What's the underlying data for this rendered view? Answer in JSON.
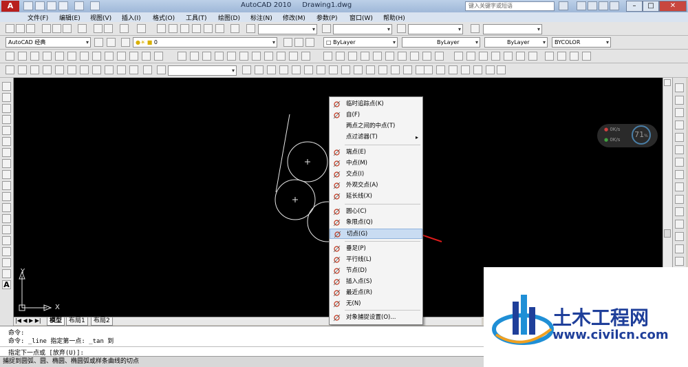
{
  "window": {
    "title": "AutoCAD 2010",
    "document": "Drawing1.dwg",
    "app_logo": "A",
    "help_search_placeholder": "键入关键字或短语",
    "controls": [
      "–",
      "□",
      "✕"
    ]
  },
  "menubar": {
    "items": [
      "文件(F)",
      "编辑(E)",
      "视图(V)",
      "插入(I)",
      "格式(O)",
      "工具(T)",
      "绘图(D)",
      "标注(N)",
      "修改(M)",
      "参数(P)",
      "窗口(W)",
      "帮助(H)"
    ]
  },
  "toolbars": {
    "workspace": "AutoCAD 经典",
    "layer": "0",
    "color": "ByLayer",
    "linetype": "ByLayer",
    "lineweight": "ByLayer",
    "plotstyle": "BYCOLOR"
  },
  "ucs": {
    "x_label": "X",
    "y_label": "Y"
  },
  "layout_tabs": [
    "模型",
    "布局1",
    "布局2"
  ],
  "context_menu": {
    "items": [
      {
        "label": "临时追踪点(K)",
        "icon": "temp-track-icon"
      },
      {
        "label": "自(F)",
        "icon": "from-icon"
      },
      {
        "label": "两点之间的中点(T)",
        "icon": ""
      },
      {
        "label": "点过滤器(T)",
        "icon": "",
        "submenu": "▸"
      },
      {
        "label": "端点(E)",
        "icon": "endpoint-icon"
      },
      {
        "label": "中点(M)",
        "icon": "midpoint-icon"
      },
      {
        "label": "交点(I)",
        "icon": "intersection-icon"
      },
      {
        "label": "外观交点(A)",
        "icon": "apparent-intersection-icon"
      },
      {
        "label": "延长线(X)",
        "icon": "extension-icon"
      },
      {
        "label": "圆心(C)",
        "icon": "center-icon"
      },
      {
        "label": "象限点(Q)",
        "icon": "quadrant-icon"
      },
      {
        "label": "切点(G)",
        "icon": "tangent-icon",
        "highlight": true
      },
      {
        "label": "垂足(P)",
        "icon": "perpendicular-icon"
      },
      {
        "label": "平行线(L)",
        "icon": "parallel-icon"
      },
      {
        "label": "节点(D)",
        "icon": "node-icon"
      },
      {
        "label": "插入点(S)",
        "icon": "insert-icon"
      },
      {
        "label": "最近点(R)",
        "icon": "nearest-icon"
      },
      {
        "label": "无(N)",
        "icon": "none-icon"
      },
      {
        "label": "对象捕捉设置(O)...",
        "icon": "osnap-settings-icon"
      }
    ]
  },
  "gauge": {
    "percent": "71",
    "percent_sign": "%",
    "rate1": "0K/s",
    "rate2": "0K/s"
  },
  "command_line": {
    "lines": [
      "命令:",
      "命令: _line 指定第一点: _tan 到",
      "指定下一点或 [放弃(U)]:"
    ]
  },
  "status_text": "捕捉到圆弧、圆、椭圆、椭圆弧或样条曲线的切点",
  "watermark": {
    "name": "土木工程网",
    "url": "www.civilcn.com"
  },
  "colors": {
    "canvas": "#000000",
    "menu_highlight": "#c9dcf2",
    "arrow": "#e01b1b",
    "watermark_blue": "#1f3f9a"
  }
}
